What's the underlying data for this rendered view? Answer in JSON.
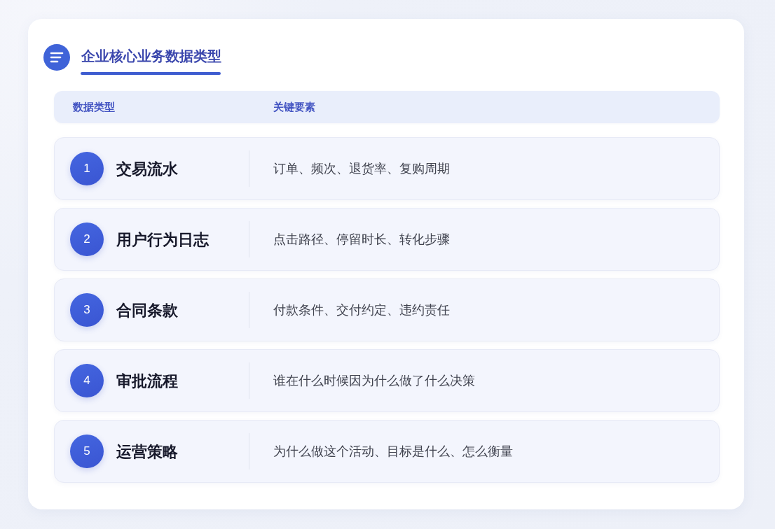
{
  "title": "企业核心业务数据类型",
  "table": {
    "columns": [
      "数据类型",
      "关键要素"
    ],
    "rows": [
      {
        "number": "1",
        "type": "交易流水",
        "elements": "订单、频次、退货率、复购周期"
      },
      {
        "number": "2",
        "type": "用户行为日志",
        "elements": "点击路径、停留时长、转化步骤"
      },
      {
        "number": "3",
        "type": "合同条款",
        "elements": "付款条件、交付约定、违约责任"
      },
      {
        "number": "4",
        "type": "审批流程",
        "elements": "谁在什么时候因为什么做了什么决策"
      },
      {
        "number": "5",
        "type": "运营策略",
        "elements": "为什么做这个活动、目标是什么、怎么衡量"
      }
    ]
  }
}
